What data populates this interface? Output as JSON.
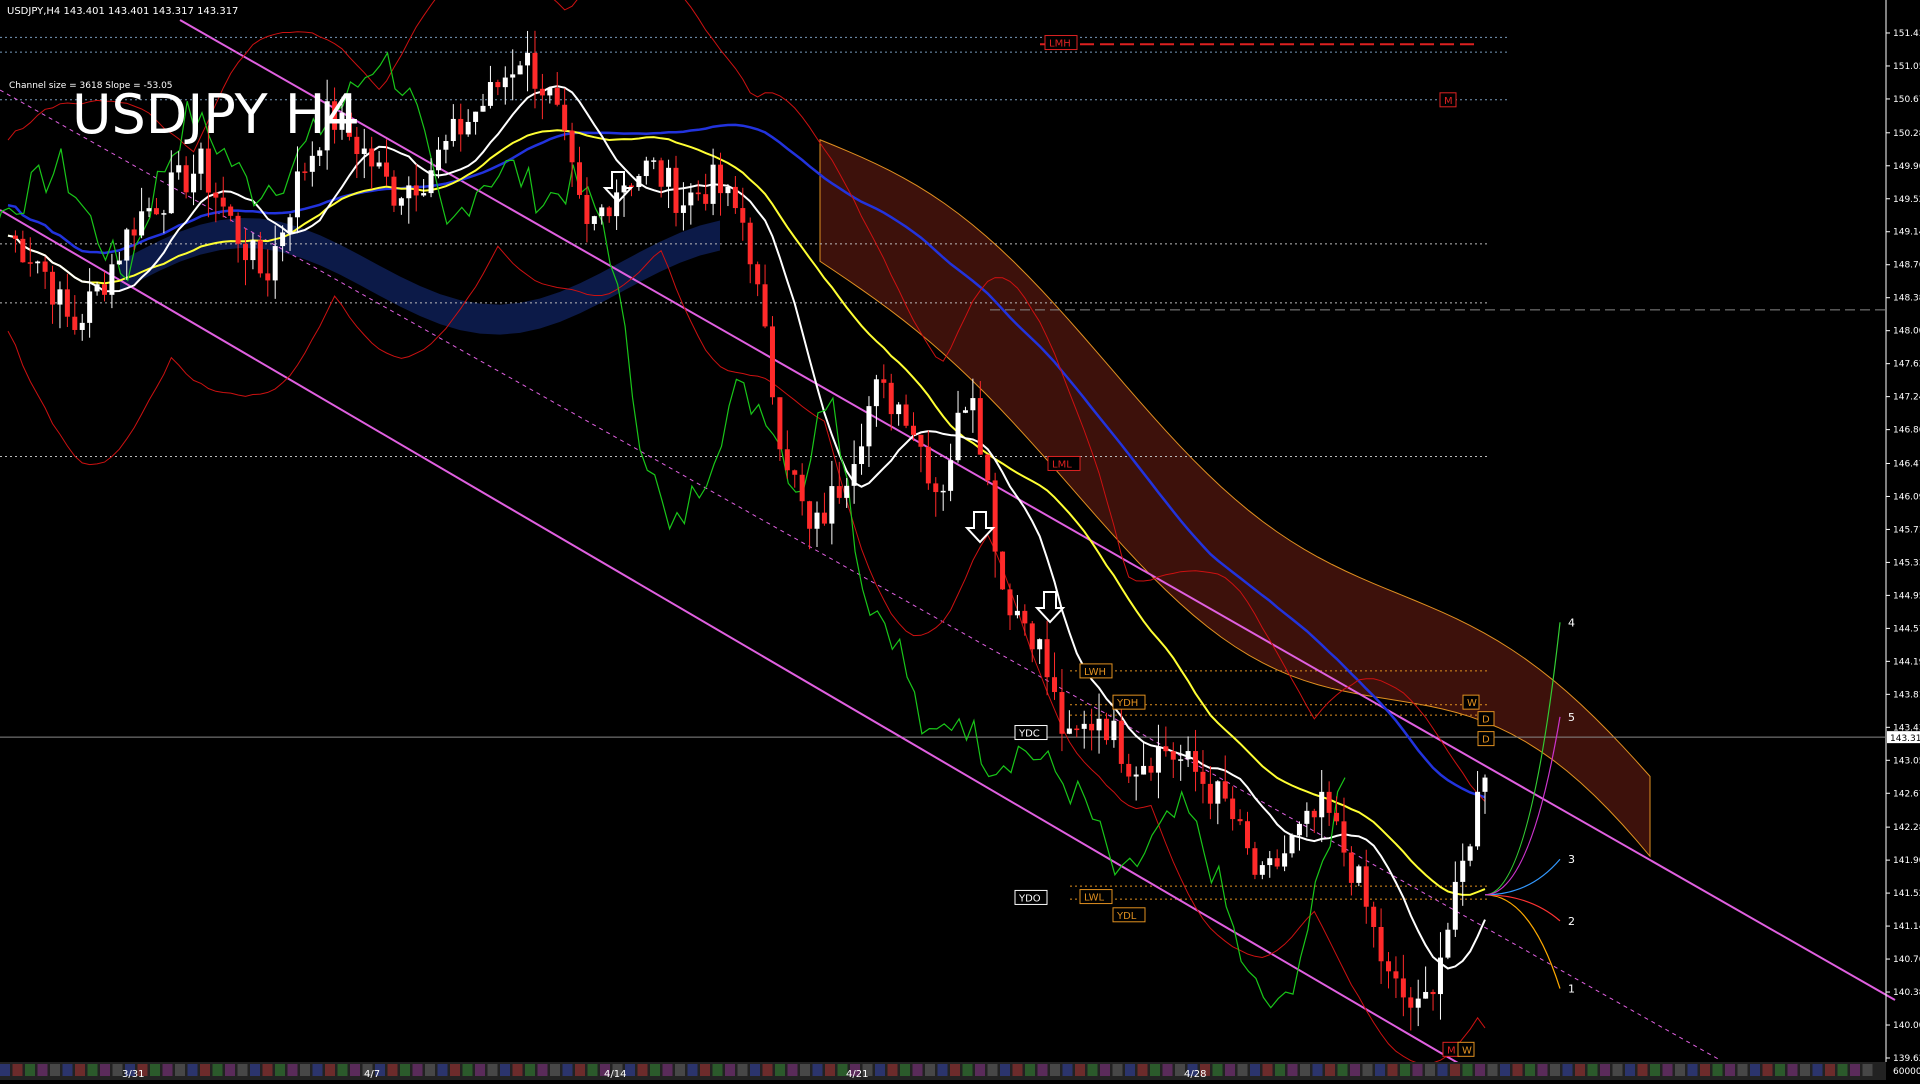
{
  "header": {
    "symbol_info": "USDJPY,H4  143.401 143.401 143.317 143.317",
    "channel_info": "Channel size = 3618 Slope = -53.05",
    "watermark": "USDJPY H4"
  },
  "colors": {
    "background": "#000000",
    "bull_candle": "#ffffff",
    "bear_candle": "#ff2a2a",
    "channel": "#e060e0",
    "ma_white": "#ffffff",
    "ma_yellow": "#ffff33",
    "ma_blue": "#2233dd",
    "chikou_green": "#19c619",
    "cloud_red": "#b03020",
    "bollinger_red": "#cc1111",
    "level_orange": "#e09020"
  },
  "chart_data": {
    "type": "candlestick",
    "symbol": "USDJPY",
    "timeframe": "H4",
    "ylim": [
      139.62,
      151.81
    ],
    "last_price": 143.317,
    "price_ticks": [
      "151.430",
      "151.050",
      "150.670",
      "150.280",
      "149.900",
      "149.520",
      "149.140",
      "148.760",
      "148.380",
      "148.000",
      "147.620",
      "147.240",
      "146.860",
      "146.470",
      "146.090",
      "145.710",
      "145.330",
      "144.950",
      "144.570",
      "144.190",
      "143.810",
      "143.430",
      "143.050",
      "142.670",
      "142.280",
      "141.900",
      "141.520",
      "141.140",
      "140.760",
      "140.380",
      "140.000",
      "139.620"
    ],
    "x_ticks": [
      "3/31",
      "4/7",
      "4/14",
      "4/21",
      "4/28"
    ],
    "volume_tick": "60000",
    "close_path": [
      149.1,
      148.8,
      148.0,
      148.6,
      149.3,
      149.6,
      149.9,
      149.2,
      148.6,
      149.7,
      150.5,
      150.1,
      149.6,
      149.8,
      150.3,
      150.7,
      151.2,
      150.6,
      149.1,
      149.7,
      149.9,
      149.5,
      149.7,
      149.2,
      146.9,
      145.6,
      146.3,
      147.3,
      147.1,
      146.1,
      147.5,
      145.0,
      144.5,
      143.2,
      143.6,
      143.0,
      143.2,
      142.9,
      142.5,
      141.6,
      142.1,
      142.5,
      141.7,
      140.5,
      140.1,
      141.3,
      143.0
    ],
    "level_labels": [
      {
        "text": "LMH",
        "price": 151.32
      },
      {
        "text": "M",
        "price": 150.66
      },
      {
        "text": "LML",
        "price": 146.47
      },
      {
        "text": "LWH",
        "price": 144.08
      },
      {
        "text": "YDH",
        "price": 143.72
      },
      {
        "text": "YDC",
        "price": 143.37
      },
      {
        "text": "YDO",
        "price": 141.47
      },
      {
        "text": "LWL",
        "price": 141.48
      },
      {
        "text": "YDL",
        "price": 141.27
      },
      {
        "text": "W",
        "price": 143.72
      },
      {
        "text": "D",
        "price": 143.53
      },
      {
        "text": "D",
        "price": 143.3
      },
      {
        "text": "M",
        "price": 139.72
      },
      {
        "text": "W",
        "price": 139.72
      }
    ],
    "horizontal_levels": [
      151.38,
      151.21,
      150.66,
      149.0,
      148.24,
      148.32,
      146.55,
      144.08,
      143.69,
      143.57,
      141.6,
      141.45
    ],
    "projection_labels": [
      {
        "text": "1",
        "price": 140.42
      },
      {
        "text": "2",
        "price": 141.2
      },
      {
        "text": "3",
        "price": 141.91
      },
      {
        "text": "4",
        "price": 144.64
      },
      {
        "text": "5",
        "price": 143.55
      }
    ]
  }
}
